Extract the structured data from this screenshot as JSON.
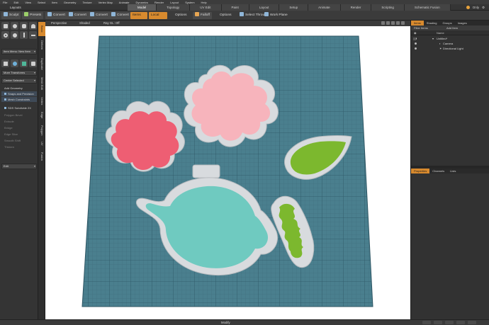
{
  "menubar": {
    "items": [
      "File",
      "Edit",
      "View",
      "Select",
      "Item",
      "Geometry",
      "Texture",
      "Vertex Map",
      "Animate",
      "Dynamics",
      "Render",
      "Layout",
      "System",
      "Help"
    ]
  },
  "layoutbar": {
    "workspace": "Layouts",
    "tabs": [
      "Model",
      "Topology",
      "UV Edit",
      "Paint",
      "Layout",
      "Setup",
      "Animate",
      "Render",
      "Scripting",
      "Schematic Fusion"
    ],
    "active_tab": "Model",
    "right_label": "Only"
  },
  "toolbar": {
    "sculpt": "Sculpt",
    "presets": "Presets",
    "convert_labels": [
      "Convert",
      "Convert",
      "Convert",
      "Convert"
    ],
    "items": "Items",
    "local": "Local",
    "options": "Options",
    "falloff": "Falloff",
    "options2": "Options",
    "select_through": "Select Through",
    "work_plane": "Work Plane"
  },
  "leftpanel": {
    "menu_dropdown": "Item Menu: New Item",
    "more_transforms": "More Transforms",
    "center_selected": "Center Selected",
    "add_geometry": "Add Geometry",
    "rows": [
      {
        "label": "Snaps and Precision",
        "state": "normal"
      },
      {
        "label": "Mesh Constraints",
        "state": "normal"
      },
      {
        "label": "SDS Subdivide 2X",
        "state": "normal"
      },
      {
        "label": "Polygon Bevel",
        "state": "dim"
      },
      {
        "label": "Extrude",
        "state": "dim"
      },
      {
        "label": "Bridge",
        "state": "dim"
      },
      {
        "label": "Edge Slice",
        "state": "dim"
      },
      {
        "label": "Smooth Shift",
        "state": "dim"
      },
      {
        "label": "Thicken",
        "state": "dim"
      }
    ],
    "bottom_dropdown": "Edit"
  },
  "vtabs": [
    "Basic",
    "Deform",
    "Duplicate",
    "Mesh Edit",
    "Vertex",
    "Edge",
    "Polygon",
    "UV",
    "Fusion"
  ],
  "viewport": {
    "view": "Perspective",
    "shading": "Shaded",
    "ray_gl": "Ray GL: Off"
  },
  "rightpanel": {
    "tabs": [
      "Items",
      "Shading",
      "Groups",
      "Images"
    ],
    "filter": "Filter Items",
    "add_item": "Add Item",
    "col_name": "Name",
    "items": [
      {
        "name": "Untitled*",
        "indent": 0
      },
      {
        "name": "Camera",
        "indent": 1
      },
      {
        "name": "Directional Light",
        "indent": 1
      }
    ],
    "bottom_tabs": [
      "Properties",
      "Channels",
      "Lists"
    ]
  },
  "statusbar": {
    "center": "Modify"
  },
  "colors": {
    "accent": "#d88a2e",
    "floor": "#4a7f8e",
    "pink_cutter": "#ee5e73",
    "light_pink_cutter": "#f7b4bc",
    "green_leaf": "#7cb82e",
    "teapot": "#6fcac0",
    "cutter_rim": "#e4e6e8"
  }
}
